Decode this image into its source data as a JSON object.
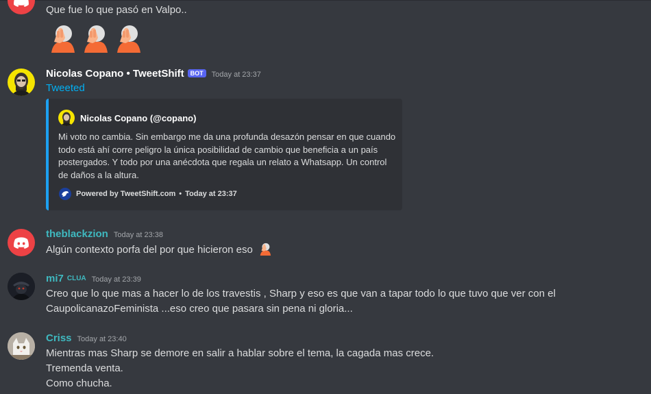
{
  "messages": {
    "m0": {
      "text": "Que fue lo que pasó en Valpo..",
      "emojis": [
        "facepalm-emoji",
        "facepalm-emoji",
        "facepalm-emoji"
      ]
    },
    "m1": {
      "username": "Nicolas Copano • TweetShift",
      "badge": "BOT",
      "timestamp": "Today at 23:37",
      "tweeted_label": "Tweeted",
      "embed": {
        "author": "Nicolas Copano (@copano)",
        "lines": [
          "Mi voto no cambia. Sin embargo me da una profunda desazón pensar en que cuando",
          "todo está ahí corre peligro la única posibilidad de cambio que beneficia a un país",
          "postergados. Y todo por una anécdota que regala un relato a Whatsapp. Un control",
          "de daños a la altura."
        ],
        "footer_powered": "Powered by TweetShift.com",
        "footer_sep": "•",
        "footer_time": "Today at 23:37",
        "accent_color": "#1da1f2"
      }
    },
    "m2": {
      "username": "theblackzion",
      "timestamp": "Today at 23:38",
      "text": "Algún contexto porfa del por que hicieron eso",
      "name_color": "#3fb9c0"
    },
    "m3": {
      "username": "mi7",
      "tag": "CLUA",
      "timestamp": "Today at 23:39",
      "lines": [
        "Creo que lo que mas a hacer lo de los travestis , Sharp y eso es que van a tapar todo lo que tuvo que ver con el",
        "CaupolicanazoFeminista ...eso creo que pasara sin pena ni gloria..."
      ],
      "name_color": "#3fb9c0"
    },
    "m4": {
      "username": "Criss",
      "timestamp": "Today at 23:40",
      "lines": [
        "Mientras mas Sharp se demore en salir a hablar sobre el tema, la cagada mas crece.",
        "Tremenda venta.",
        "Como chucha."
      ],
      "name_color": "#3fb9c0"
    }
  },
  "colors": {
    "background": "#36393f",
    "text": "#dcddde",
    "link": "#00b0f4",
    "bot_badge": "#5865f2",
    "discord_red": "#ed4245"
  }
}
